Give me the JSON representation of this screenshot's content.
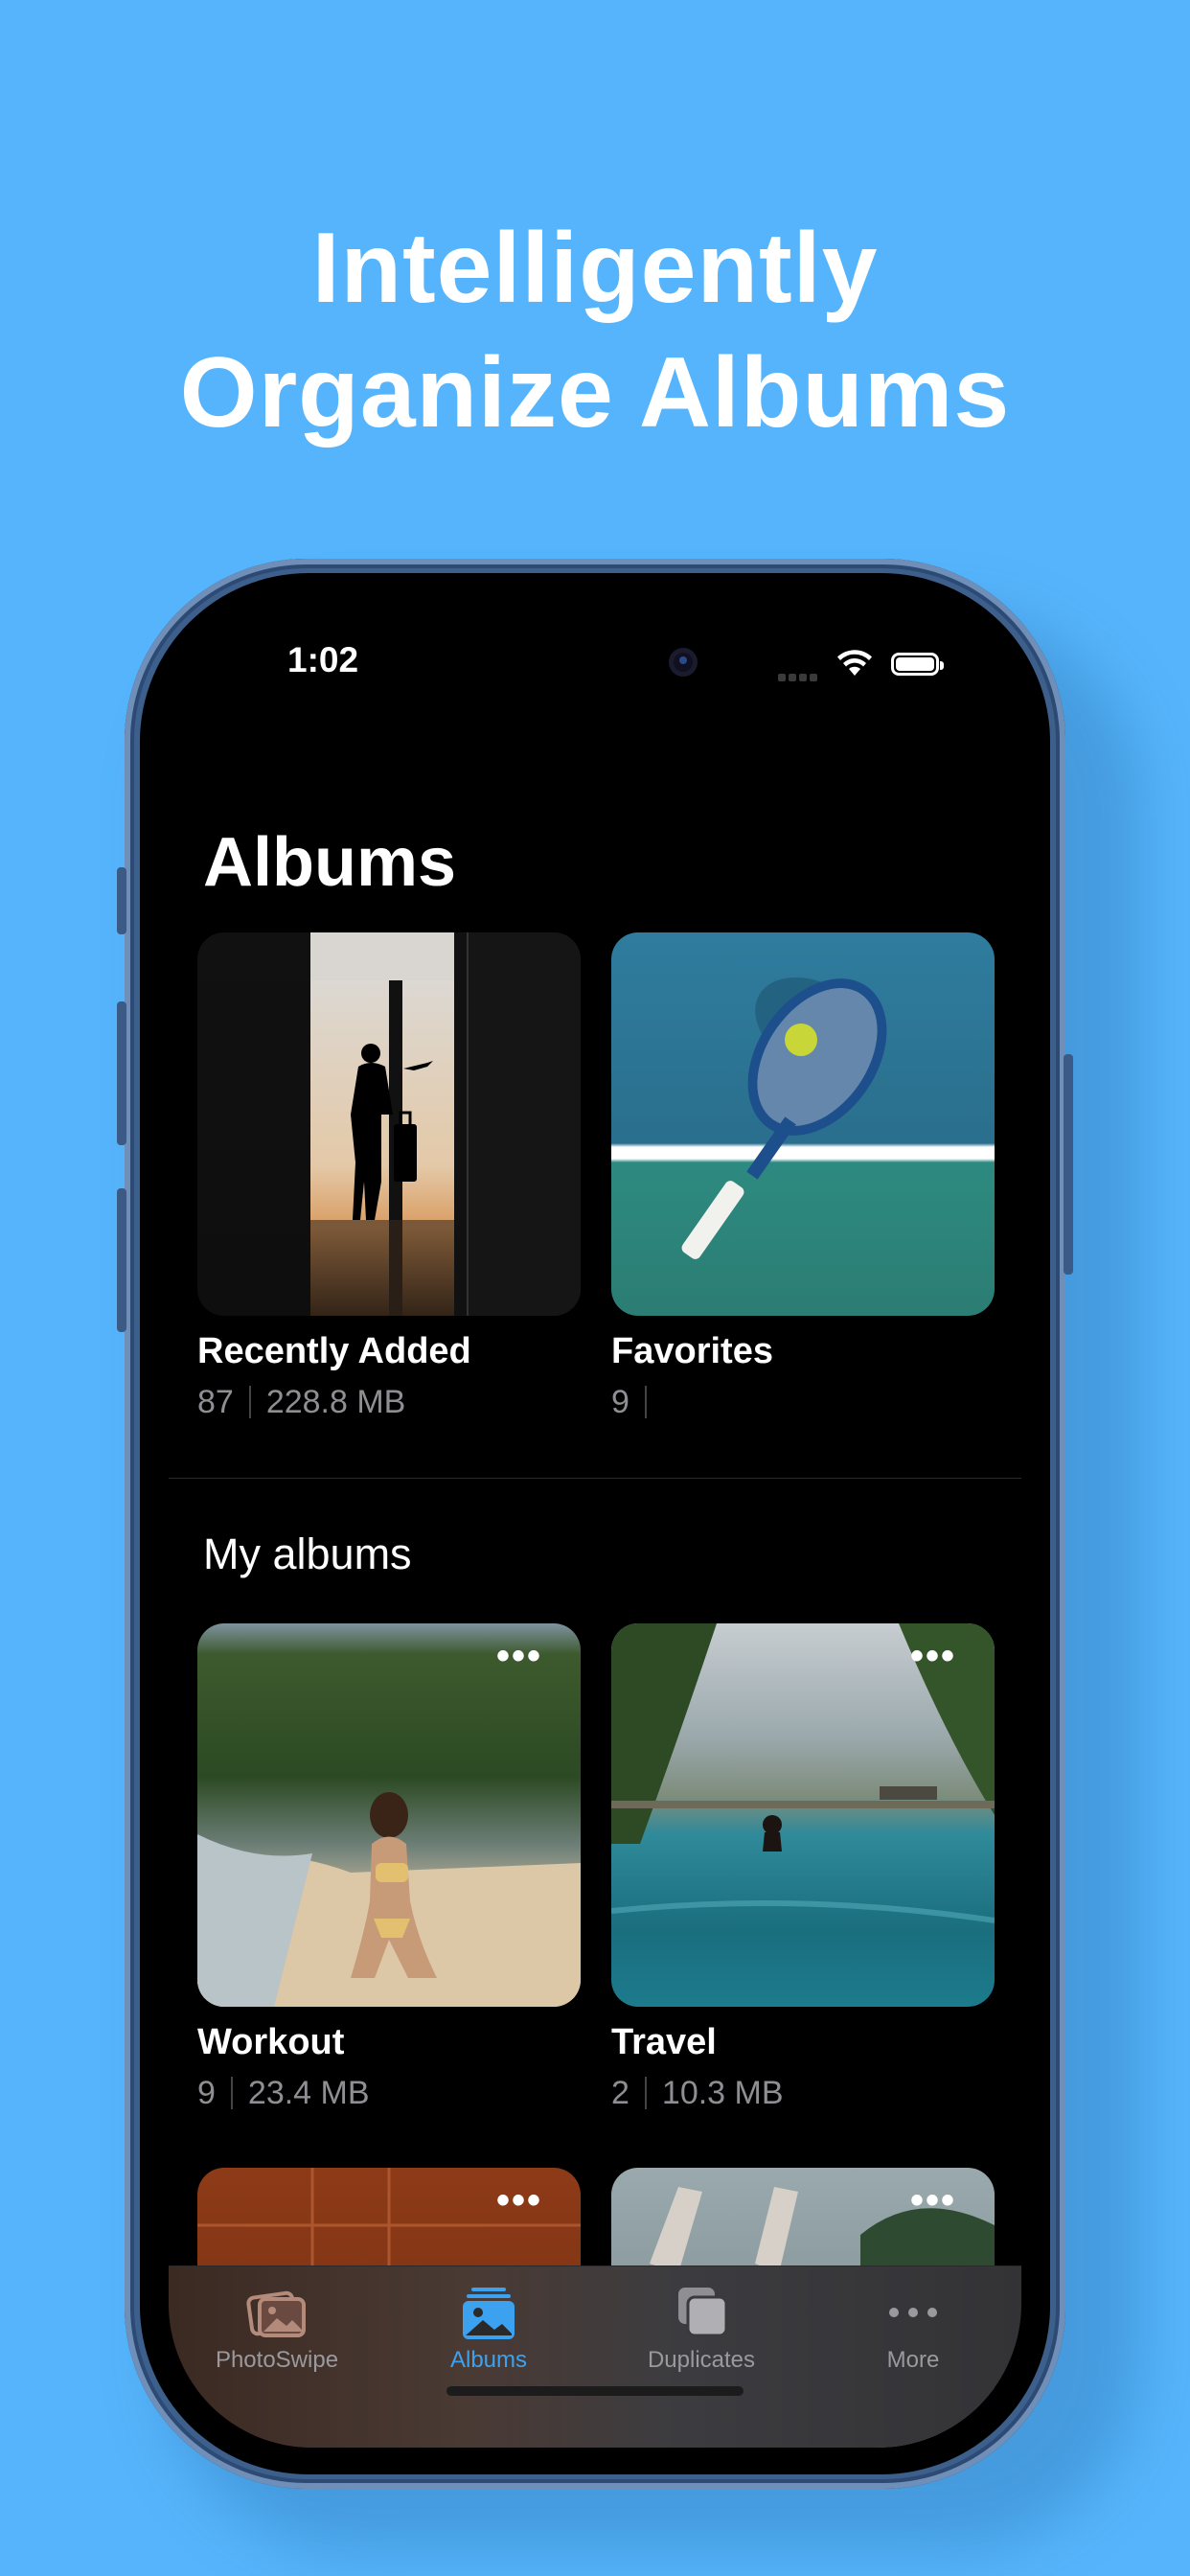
{
  "headline": {
    "line1": "Intelligently",
    "line2": "Organize Albums"
  },
  "status_bar": {
    "time": "1:02"
  },
  "page_title": "Albums",
  "system_albums": [
    {
      "title": "Recently Added",
      "count": "87",
      "size": "228.8 MB",
      "image": "silhouette-traveler-airport"
    },
    {
      "title": "Favorites",
      "count": "9",
      "size": "",
      "image": "tennis-racket-ball"
    }
  ],
  "section_title": "My albums",
  "my_albums": [
    {
      "title": "Workout",
      "count": "9",
      "size": "23.4 MB",
      "more_label": "•••",
      "image": "woman-on-beach"
    },
    {
      "title": "Travel",
      "count": "2",
      "size": "10.3 MB",
      "more_label": "•••",
      "image": "infinity-pool"
    },
    {
      "title": "",
      "count": "",
      "size": "",
      "more_label": "•••",
      "image": "tennis-court"
    },
    {
      "title": "",
      "count": "",
      "size": "",
      "more_label": "•••",
      "image": "yoga-pose"
    }
  ],
  "tab_bar": {
    "tabs": [
      {
        "label": "PhotoSwipe",
        "icon": "photos-stack-icon",
        "active": false
      },
      {
        "label": "Albums",
        "icon": "album-icon",
        "active": true
      },
      {
        "label": "Duplicates",
        "icon": "duplicates-icon",
        "active": false
      },
      {
        "label": "More",
        "icon": "more-dots-icon",
        "active": false
      }
    ]
  },
  "colors": {
    "background": "#55b4fb",
    "accent": "#3ca2f0",
    "secondary_text": "#8e8e93"
  }
}
